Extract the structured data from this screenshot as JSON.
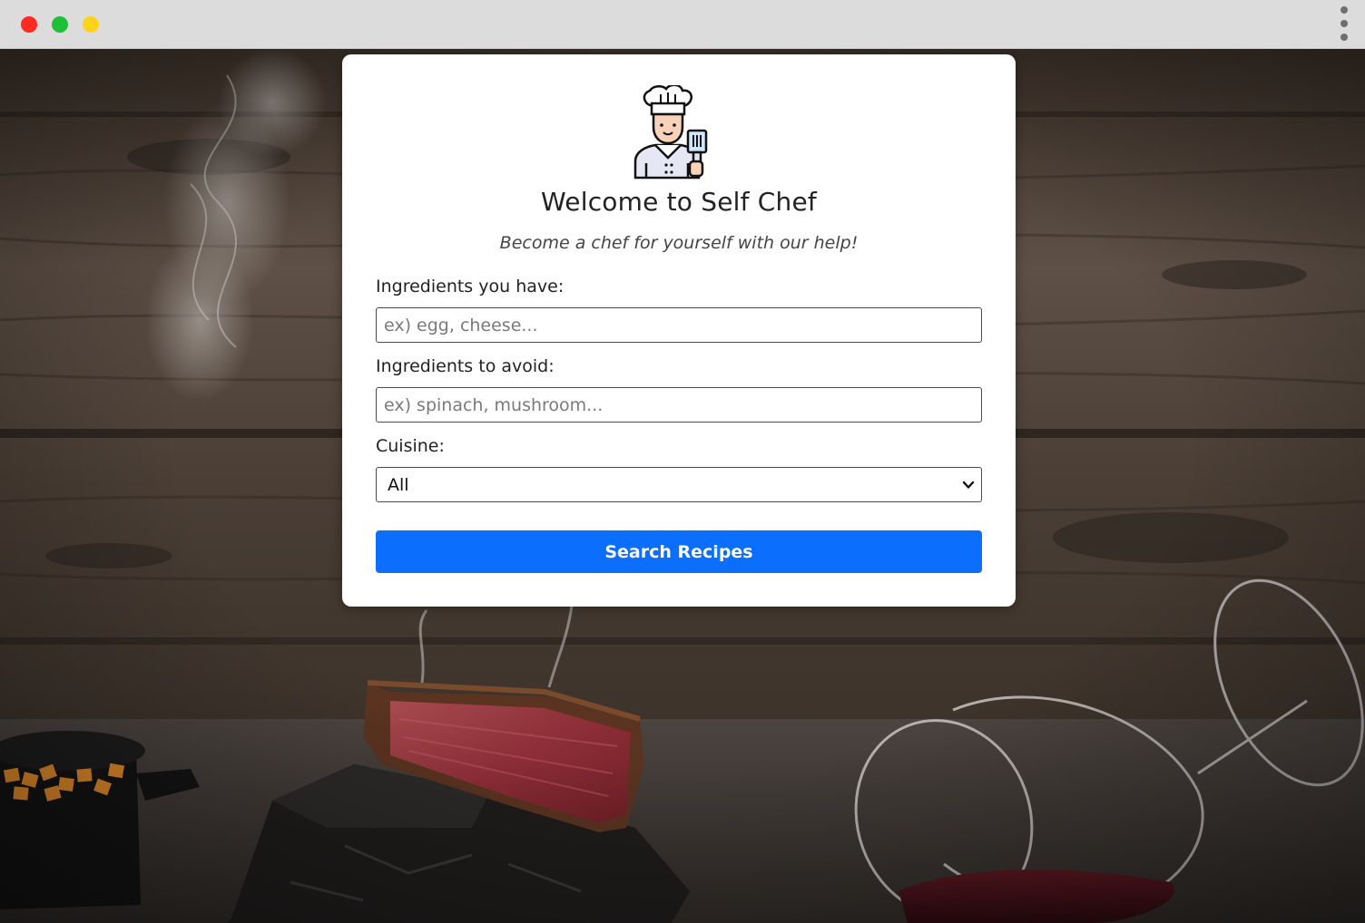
{
  "browser": {
    "window_controls": [
      "close",
      "maximize",
      "minimize"
    ],
    "menu_icon": "kebab-menu-icon"
  },
  "header": {
    "logo_icon": "chef-icon",
    "title": "Welcome to Self Chef",
    "subtitle": "Become a chef for yourself with our help!"
  },
  "form": {
    "have": {
      "label": "Ingredients you have:",
      "placeholder": "ex) egg, cheese...",
      "value": ""
    },
    "avoid": {
      "label": "Ingredients to avoid:",
      "placeholder": "ex) spinach, mushroom...",
      "value": ""
    },
    "cuisine": {
      "label": "Cuisine:",
      "selected": "All"
    },
    "submit_label": "Search Recipes"
  },
  "colors": {
    "primary_button": "#0b6efd",
    "card_background": "#ffffff",
    "titlebar": "#dcdcdc",
    "traffic_red": "#ff2a22",
    "traffic_green": "#1ec038",
    "traffic_yellow": "#ffd21c"
  }
}
